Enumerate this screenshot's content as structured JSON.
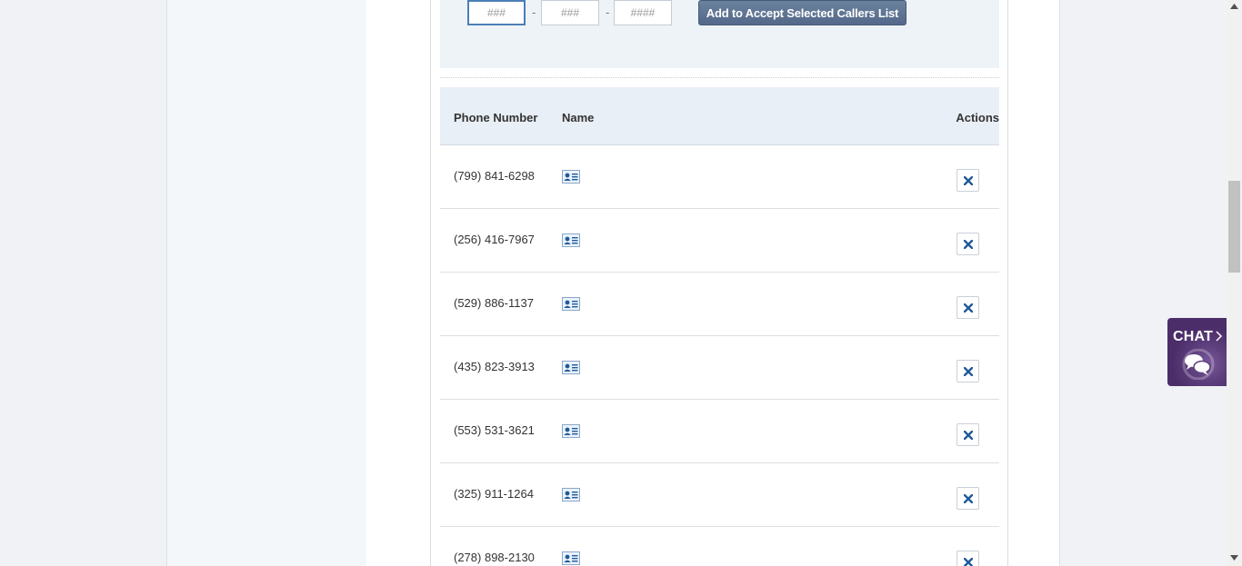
{
  "entry": {
    "area_placeholder": "###",
    "prefix_placeholder": "###",
    "line_placeholder": "####",
    "separator": "-",
    "add_button_label": "Add to Accept Selected Callers List"
  },
  "table": {
    "headers": {
      "phone": "Phone Number",
      "name": "Name",
      "actions": "Actions"
    },
    "rows": [
      {
        "phone": "(799) 841-6298"
      },
      {
        "phone": "(256) 416-7967"
      },
      {
        "phone": "(529) 886-1137"
      },
      {
        "phone": "(435) 823-3913"
      },
      {
        "phone": "(553) 531-3621"
      },
      {
        "phone": "(325) 911-1264"
      },
      {
        "phone": "(278) 898-2130"
      }
    ]
  },
  "chat": {
    "label": "CHAT"
  },
  "icons": {
    "contact_card": "contact-card-icon",
    "delete": "close-icon",
    "chat": "chat-bubbles-icon"
  },
  "colors": {
    "accent": "#5b7090",
    "delete_x": "#1f5a99",
    "chat_bg": "#5e3f7e"
  }
}
